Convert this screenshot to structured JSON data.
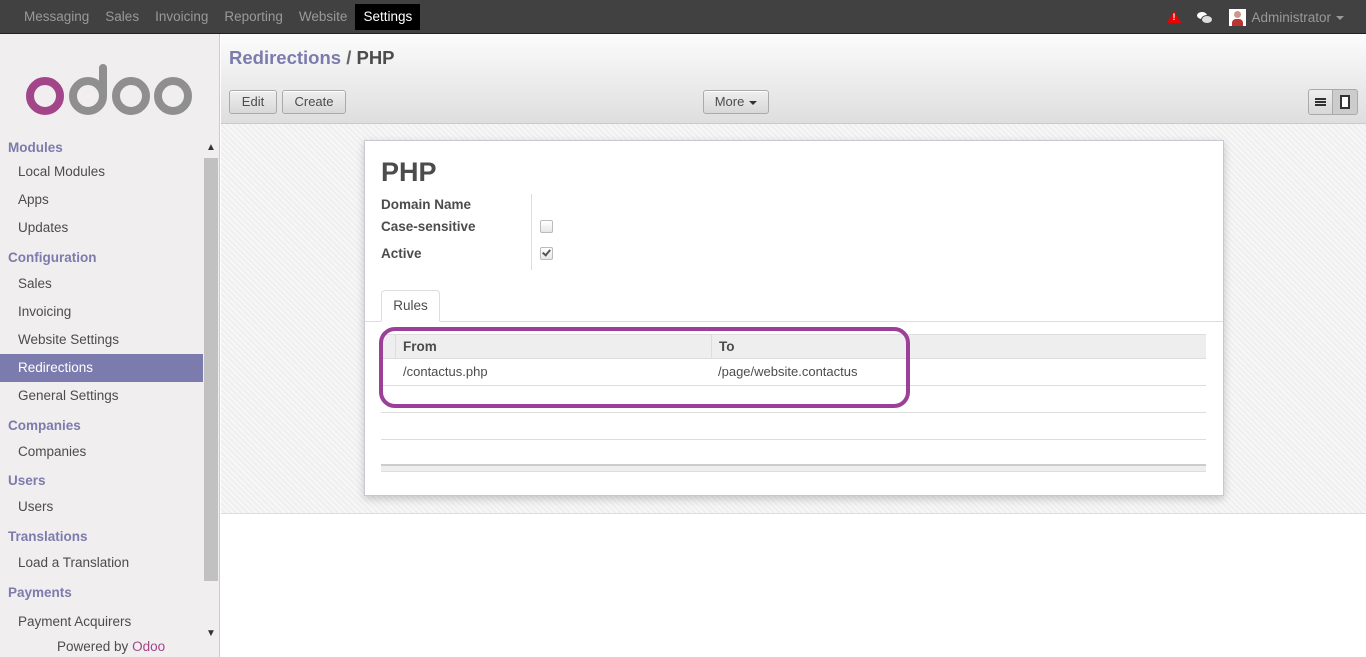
{
  "topbar": {
    "menu": [
      "Messaging",
      "Sales",
      "Invoicing",
      "Reporting",
      "Website",
      "Settings"
    ],
    "active": "Settings",
    "user": "Administrator",
    "icons": [
      "alert-icon",
      "chat-icon",
      "avatar"
    ]
  },
  "sidebar": {
    "logo": "odoo",
    "sections": [
      {
        "title": "Modules",
        "items": [
          "Local Modules",
          "Apps",
          "Updates"
        ]
      },
      {
        "title": "Configuration",
        "items": [
          "Sales",
          "Invoicing",
          "Website Settings",
          "Redirections",
          "General Settings"
        ]
      },
      {
        "title": "Companies",
        "items": [
          "Companies"
        ]
      },
      {
        "title": "Users",
        "items": [
          "Users"
        ]
      },
      {
        "title": "Translations",
        "items": [
          "Load a Translation"
        ]
      },
      {
        "title": "Payments",
        "items": [
          "Payment Acquirers"
        ]
      }
    ],
    "active_item": "Redirections",
    "powered_prefix": "Powered by",
    "powered_brand": "Odoo"
  },
  "control_panel": {
    "breadcrumb_parent": "Redirections",
    "breadcrumb_sep": "/",
    "breadcrumb_current": "PHP",
    "edit_label": "Edit",
    "create_label": "Create",
    "more_label": "More"
  },
  "form": {
    "title": "PHP",
    "domain_label": "Domain Name",
    "case_label": "Case-sensitive",
    "case_value": false,
    "active_label": "Active",
    "active_value": true,
    "tab_rules": "Rules",
    "table": {
      "col_from": "From",
      "col_to": "To",
      "rows": [
        {
          "from": "/contactus.php",
          "to": "/page/website.contactus"
        }
      ]
    }
  },
  "colors": {
    "brand": "#7c7bad",
    "topbar": "#414141",
    "highlight": "#9c3f98",
    "odoo_magenta": "#a24689"
  }
}
